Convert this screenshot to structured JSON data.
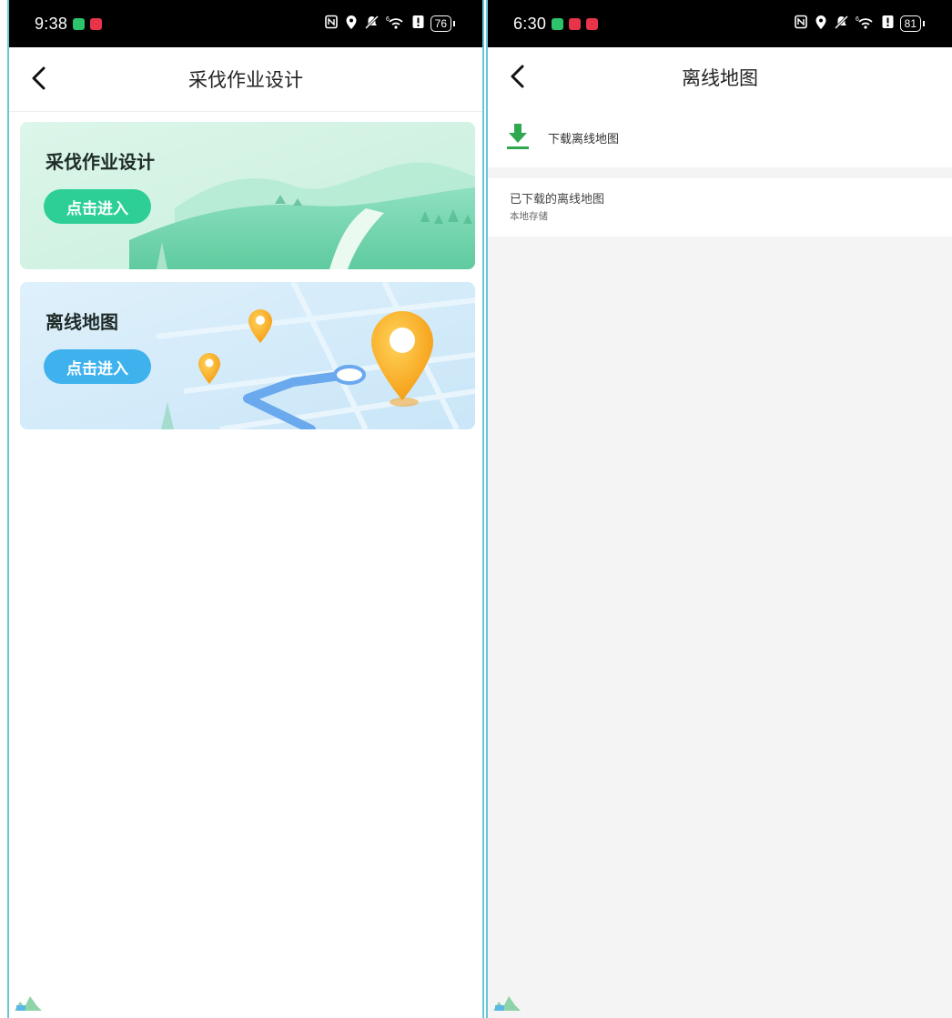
{
  "left": {
    "status": {
      "time": "9:38",
      "battery": "76"
    },
    "header": {
      "title": "采伐作业设计"
    },
    "cards": [
      {
        "title": "采伐作业设计",
        "button": "点击进入"
      },
      {
        "title": "离线地图",
        "button": "点击进入"
      }
    ]
  },
  "right": {
    "status": {
      "time": "6:30",
      "battery": "81"
    },
    "header": {
      "title": "离线地图"
    },
    "download": {
      "label": "下载离线地图"
    },
    "downloaded": {
      "title": "已下载的离线地图",
      "subtitle": "本地存储"
    }
  },
  "colors": {
    "card_button_green": "#2dcf97",
    "card_button_blue": "#3fb2ee",
    "download_icon": "#2fa84f",
    "frame_border": "#69c7d3"
  },
  "icons": [
    "back-arrow-icon",
    "download-icon",
    "nfc-icon",
    "location-icon",
    "mute-icon",
    "wifi-icon",
    "alert-icon",
    "battery-icon"
  ]
}
